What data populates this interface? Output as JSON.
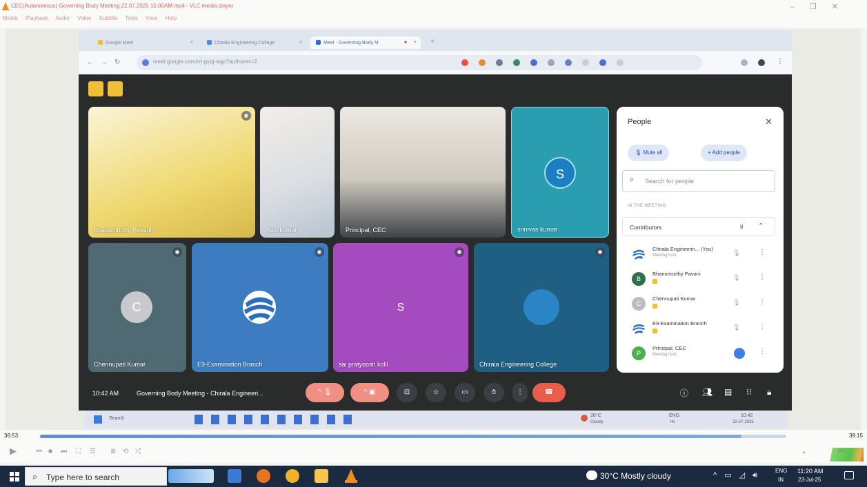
{
  "vlc": {
    "title": "CEC(Autonomous) Governing Body Meeting 22.07.2025 10.00AM.mp4 - VLC media player",
    "menu": [
      "Media",
      "Playback",
      "Audio",
      "Video",
      "Subtitle",
      "Tools",
      "View",
      "Help"
    ],
    "time_elapsed": "36:53",
    "time_total": "39:15",
    "progress_fraction": 0.94,
    "volume_pct": "125%"
  },
  "browser": {
    "tabs": [
      {
        "label": "Google Meet",
        "color": "#f1bf35"
      },
      {
        "label": "Chirala Engineering College",
        "color": "#4a90d9"
      },
      {
        "label": "Meet - Governing Body M",
        "color": "#2b6fdb"
      }
    ],
    "url": "meet.google.com/rrt-gvqj-wga?authuser=2"
  },
  "meet": {
    "tiles": [
      {
        "name": "Bhanumurthy Pavani"
      },
      {
        "name": "Ravi kumar"
      },
      {
        "name": "Principal, CEC"
      },
      {
        "name": "srinivas kumar",
        "initial": "S"
      },
      {
        "name": "Chennupati Kumar",
        "initial": "C"
      },
      {
        "name": "E9-Examination Branch"
      },
      {
        "name": "sai pratyoosh kolli",
        "initial": "S"
      },
      {
        "name": "Chirala Engineering College"
      }
    ],
    "time": "10:42 AM",
    "meeting_title": "Governing Body Meeting - Chirala Engineeri...",
    "people": {
      "title": "People",
      "mute_all": "Mute all",
      "add_people": "Add people",
      "search_placeholder": "Search for people",
      "section": "IN THE MEETING",
      "group": "Contributors",
      "group_count": "8",
      "rows": [
        {
          "name": "Chirala Engineerin... (You)",
          "sub": "Meeting host",
          "initial": "",
          "color": "#ffffff"
        },
        {
          "name": "Bhanumurthy Pavani",
          "sub": "",
          "initial": "B",
          "color": "#2f6f4f"
        },
        {
          "name": "Chennupati Kumar",
          "sub": "",
          "initial": "C",
          "color": "#b9bec6"
        },
        {
          "name": "E9-Examination Branch",
          "sub": "",
          "initial": "",
          "color": "#ffffff"
        },
        {
          "name": "Principal, CEC",
          "sub": "Meeting host",
          "initial": "P",
          "color": "#4caf50"
        }
      ]
    },
    "inner_taskbar": {
      "search": "Search",
      "temp": "28°C",
      "weather": "Cloudy",
      "lang": "ENG",
      "region": "IN",
      "time": "10:42",
      "date": "22-07-2025"
    }
  },
  "taskbar": {
    "search_placeholder": "Type here to search",
    "weather": "30°C  Mostly cloudy",
    "lang": "ENG",
    "region": "IN",
    "time": "11:20 AM",
    "date": "23-Jul-25"
  }
}
